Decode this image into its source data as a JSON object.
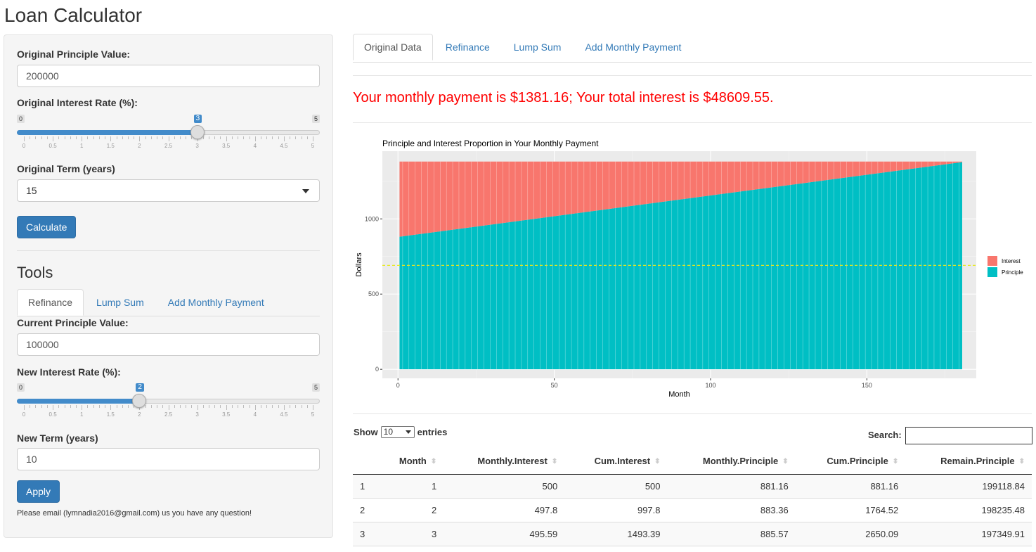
{
  "app": {
    "title": "Loan Calculator"
  },
  "sidebar": {
    "principle_label": "Original Principle Value:",
    "principle_value": "200000",
    "rate_label": "Original Interest Rate (%):",
    "rate_slider": {
      "min": 0,
      "max": 5,
      "value": 3,
      "min_label": "0",
      "max_label": "5",
      "value_label": "3",
      "ticks": [
        "0",
        "0.5",
        "1",
        "1.5",
        "2",
        "2.5",
        "3",
        "3.5",
        "4",
        "4.5",
        "5"
      ]
    },
    "term_label": "Original Term (years)",
    "term_value": "15",
    "calculate_label": "Calculate",
    "tools_title": "Tools",
    "tools_tabs": [
      {
        "label": "Refinance",
        "active": true
      },
      {
        "label": "Lump Sum",
        "active": false
      },
      {
        "label": "Add Monthly Payment",
        "active": false
      }
    ],
    "current_principle_label": "Current Principle Value:",
    "current_principle_value": "100000",
    "new_rate_label": "New Interest Rate (%):",
    "new_rate_slider": {
      "min": 0,
      "max": 5,
      "value": 2,
      "min_label": "0",
      "max_label": "5",
      "value_label": "2",
      "ticks": [
        "0",
        "0.5",
        "1",
        "1.5",
        "2",
        "2.5",
        "3",
        "3.5",
        "4",
        "4.5",
        "5"
      ]
    },
    "new_term_label": "New Term (years)",
    "new_term_value": "10",
    "apply_label": "Apply",
    "footnote": "Please email (lymnadia2016@gmail.com) us you have any question!"
  },
  "main": {
    "tabs": [
      {
        "label": "Original Data",
        "active": true
      },
      {
        "label": "Refinance",
        "active": false
      },
      {
        "label": "Lump Sum",
        "active": false
      },
      {
        "label": "Add Monthly Payment",
        "active": false
      }
    ],
    "summary": "Your monthly payment is $1381.16; Your total interest is $48609.55."
  },
  "chart_data": {
    "type": "area",
    "title": "Principle and Interest Proportion in Your Monthly Payment",
    "xlabel": "Month",
    "ylabel": "Dollars",
    "xlim": [
      -5,
      185
    ],
    "ylim": [
      -60,
      1450
    ],
    "xticks": [
      0,
      50,
      100,
      150
    ],
    "yticks": [
      0,
      500,
      1000
    ],
    "x_range": [
      1,
      180
    ],
    "total_payment": 1381.16,
    "series": [
      {
        "name": "Interest",
        "color": "#F8766D",
        "start": 500,
        "end": 3.44
      },
      {
        "name": "Principle",
        "color": "#00BFC4",
        "start": 881.16,
        "end": 1377.72
      }
    ],
    "hline": {
      "y": 691,
      "color": "#e8e81c"
    },
    "legend_position": "right",
    "grid": true
  },
  "table": {
    "show_label": "Show",
    "entries_label": "entries",
    "page_length": "10",
    "search_label": "Search:",
    "columns": [
      "",
      "Month",
      "Monthly.Interest",
      "Cum.Interest",
      "Monthly.Principle",
      "Cum.Principle",
      "Remain.Principle"
    ],
    "rows": [
      [
        "1",
        "1",
        "500",
        "500",
        "881.16",
        "881.16",
        "199118.84"
      ],
      [
        "2",
        "2",
        "497.8",
        "997.8",
        "883.36",
        "1764.52",
        "198235.48"
      ],
      [
        "3",
        "3",
        "495.59",
        "1493.39",
        "885.57",
        "2650.09",
        "197349.91"
      ]
    ]
  }
}
